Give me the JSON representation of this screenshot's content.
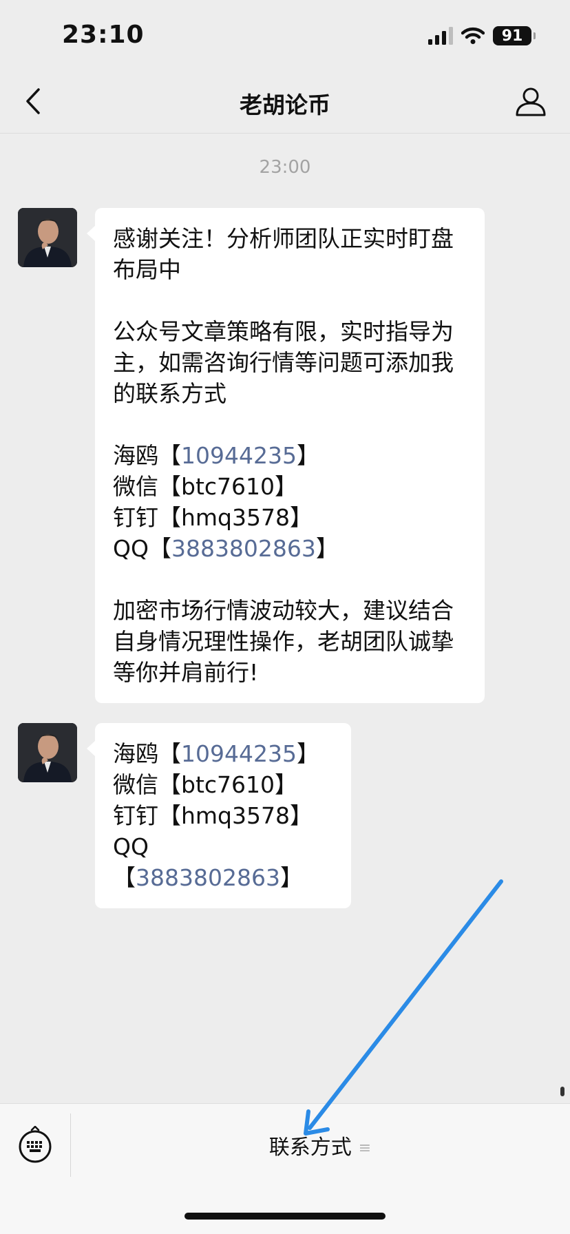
{
  "status_bar": {
    "time": "23:10",
    "battery": "91"
  },
  "nav": {
    "title": "老胡论币",
    "back_icon": "chevron-left-icon",
    "profile_icon": "person-icon"
  },
  "chat": {
    "timestamp": "23:00",
    "message1": {
      "p1": "感谢关注！分析师团队正实时盯盘布局中",
      "p2": "公众号文章策略有限，实时指导为主，如需咨询行情等问题可添加我的联系方式",
      "contacts": {
        "c1_label": "海鸥【",
        "c1_value": "10944235",
        "c1_end": "】",
        "c2": "微信【btc7610】",
        "c3": "钉钉【hmq3578】",
        "c4_label": "QQ【",
        "c4_value": "3883802863",
        "c4_end": "】"
      },
      "p3": "加密市场行情波动较大，建议结合自身情况理性操作，老胡团队诚挚等你并肩前行!"
    },
    "message2": {
      "c1_label": "海鸥【",
      "c1_value": "10944235",
      "c1_end": "】",
      "c2": "微信【btc7610】",
      "c3": "钉钉【hmq3578】",
      "c4_label": "QQ【",
      "c4_value": "3883802863",
      "c4_end": "】"
    }
  },
  "bottom_bar": {
    "menu_label": "联系方式",
    "menu_icon": "≡",
    "keyboard_icon": "keyboard-icon"
  },
  "colors": {
    "background": "#ededed",
    "link": "#576b95",
    "annotation_arrow": "#2b8be6"
  }
}
